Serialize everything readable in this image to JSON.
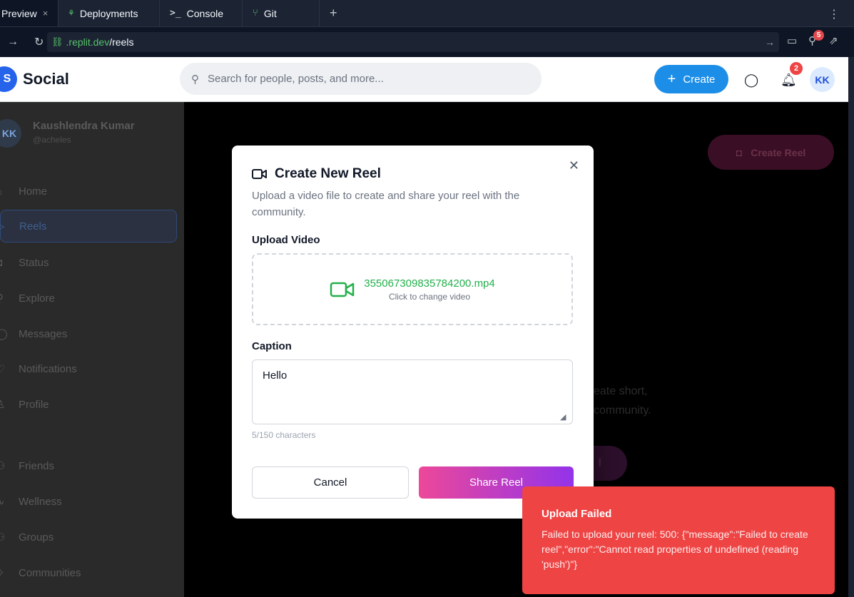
{
  "ide": {
    "tabs": [
      {
        "label": "Preview",
        "close": "×"
      },
      {
        "label": "Deployments"
      },
      {
        "label": "Console",
        "prefix": ">_"
      },
      {
        "label": "Git"
      }
    ],
    "new_tab": "+",
    "url_domain": ".replit.dev",
    "url_path": "/reels",
    "notification_badge": "5"
  },
  "header": {
    "logo_letter": "S",
    "app_name": "Social",
    "search_placeholder": "Search for people, posts, and more...",
    "create_label": "Create",
    "notification_count": "2",
    "avatar_initials": "KK"
  },
  "sidebar": {
    "user_initials": "KK",
    "user_name": "Kaushlendra Kumar",
    "user_handle": "@acheles",
    "items": [
      {
        "label": "Home",
        "icon": "home-icon"
      },
      {
        "label": "Reels",
        "icon": "play-icon"
      },
      {
        "label": "Status",
        "icon": "camera-icon"
      },
      {
        "label": "Explore",
        "icon": "search-icon"
      },
      {
        "label": "Messages",
        "icon": "chat-icon"
      },
      {
        "label": "Notifications",
        "icon": "heart-icon"
      },
      {
        "label": "Profile",
        "icon": "user-icon"
      },
      {
        "label": "Friends",
        "icon": "users-icon"
      },
      {
        "label": "Wellness",
        "icon": "pulse-icon"
      },
      {
        "label": "Groups",
        "icon": "group-icon"
      },
      {
        "label": "Communities",
        "icon": "sparkle-icon"
      }
    ]
  },
  "main": {
    "create_reel_label": "Create Reel",
    "bg_text_line1": "eate short,",
    "bg_text_line2": "community.",
    "bg_pill_label": "l"
  },
  "modal": {
    "title": "Create New Reel",
    "description": "Upload a video file to create and share your reel with the community.",
    "upload_label": "Upload Video",
    "file_name": "355067309835784200.mp4",
    "file_hint": "Click to change video",
    "caption_label": "Caption",
    "caption_value": "Hello",
    "char_count": "5/150 characters",
    "cancel_label": "Cancel",
    "share_label": "Share Reel"
  },
  "toast": {
    "title": "Upload Failed",
    "message": "Failed to upload your reel: 500: {\"message\":\"Failed to create reel\",\"error\":\"Cannot read properties of undefined (reading 'push')\"}"
  },
  "colors": {
    "accent_blue": "#1d8ee8",
    "share_gradient_start": "#ec4899",
    "share_gradient_end": "#9333ea",
    "toast_red": "#ef4444",
    "file_green": "#22b04b"
  }
}
